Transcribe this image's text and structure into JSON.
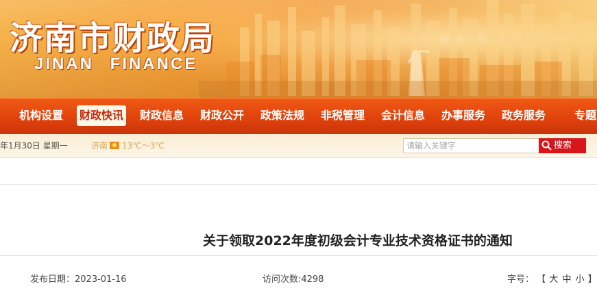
{
  "site": {
    "title": "济南市财政局",
    "subtitle": "JINAN FINANCE"
  },
  "nav": {
    "items": [
      {
        "label": "机构设置"
      },
      {
        "label": "财政快讯"
      },
      {
        "label": "财政信息"
      },
      {
        "label": "财政公开"
      },
      {
        "label": "政策法规"
      },
      {
        "label": "非税管理"
      },
      {
        "label": "会计信息"
      },
      {
        "label": "办事服务"
      },
      {
        "label": "政务服务"
      },
      {
        "label": "专题"
      }
    ],
    "active_index": 1
  },
  "infobar": {
    "date": "年1月30日 星期一",
    "city": "济南",
    "weather_icon": "sun-icon",
    "temperature": "13℃～3℃"
  },
  "search": {
    "placeholder": "请输入关键字",
    "button_label": "搜索"
  },
  "article": {
    "title": "关于领取2022年度初级会计专业技术资格证书的通知",
    "publish_label": "发布日期：2023-01-16",
    "visits_label": "访问次数:4298",
    "font_size_label": "字号：",
    "font_open": "【",
    "font_large": "大",
    "font_medium": "中",
    "font_small": "小",
    "font_close": "】"
  },
  "colors": {
    "nav_bg": "#e0420b",
    "search_button": "#d7161c",
    "banner_orange": "#f5a43a"
  }
}
